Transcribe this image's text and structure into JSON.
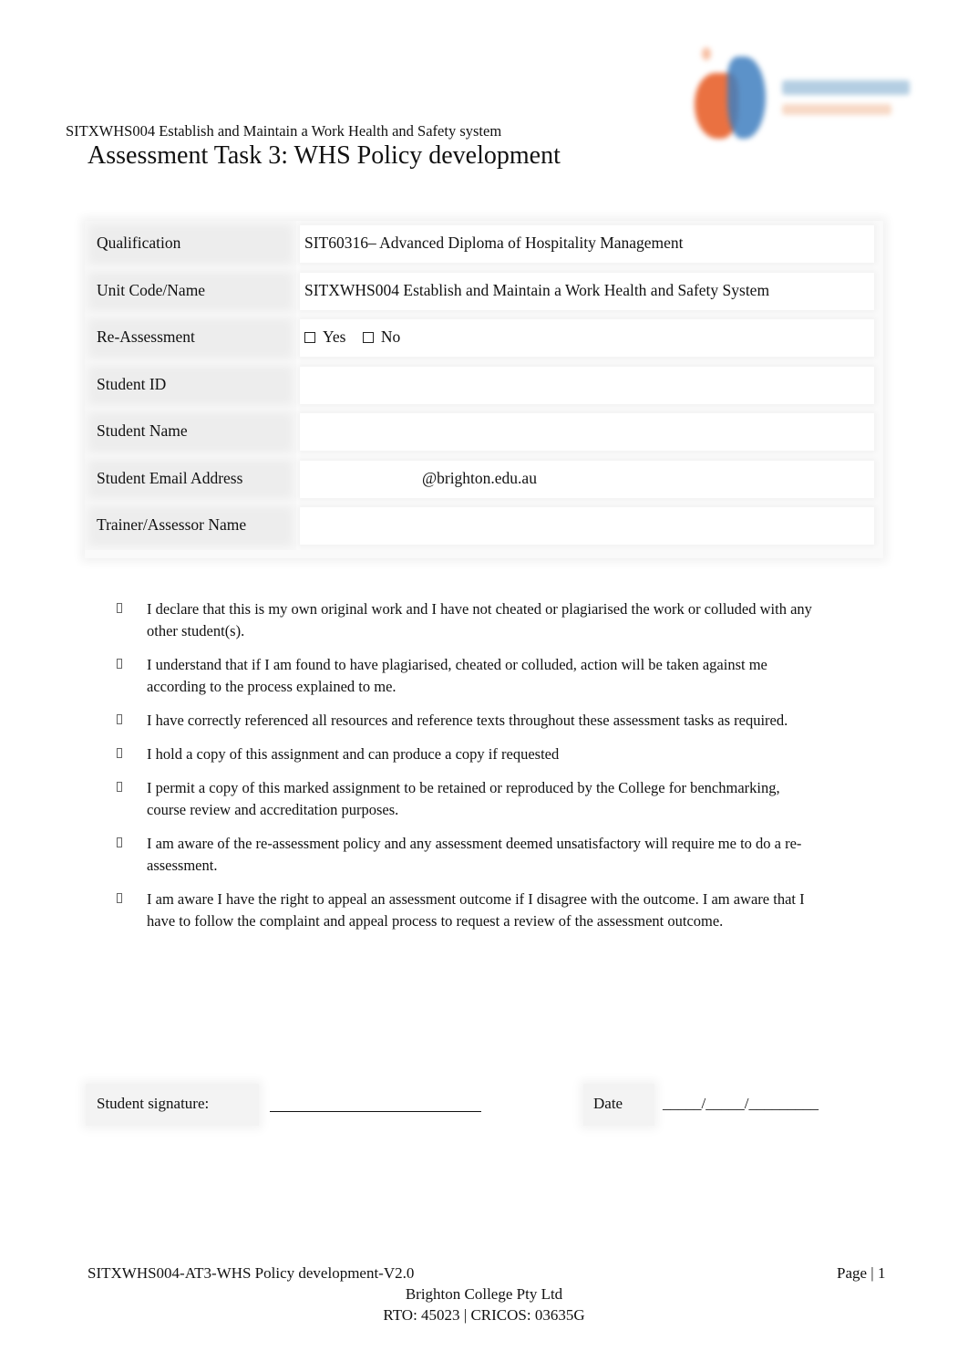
{
  "header": {
    "unit_title": "SITXWHS004 Establish and Maintain a Work Health and Safety system",
    "page_title": "Assessment Task 3: WHS Policy development",
    "logo_name": "Brighton College logo"
  },
  "info_table": {
    "rows": [
      {
        "label": "Qualification",
        "value": "SIT60316– Advanced Diploma of Hospitality Management"
      },
      {
        "label": "Unit Code/Name",
        "value": "SITXWHS004 Establish and Maintain a Work Health and Safety System"
      },
      {
        "label": "Re-Assessment",
        "options": [
          {
            "label": "Yes",
            "checked": false
          },
          {
            "label": "No",
            "checked": false
          }
        ]
      },
      {
        "label": "Student ID",
        "value": ""
      },
      {
        "label": "Student Name",
        "value": ""
      },
      {
        "label": "Student Email Address",
        "value": "",
        "suffix": "@brighton.edu.au"
      },
      {
        "label": "Trainer/Assessor Name",
        "value": ""
      }
    ]
  },
  "declarations": [
    "I declare that this is my own original work and I have not cheated or plagiarised the work or colluded with any other student(s).",
    "I understand that if I am found to have plagiarised, cheated or colluded, action will be taken against me according to the process explained to me.",
    "I have correctly referenced all resources and reference texts throughout these assessment tasks as required.",
    "I hold a copy of this assignment and can produce a copy if requested",
    "I permit a copy of this marked assignment to be retained or reproduced by the College for benchmarking, course review and accreditation purposes.",
    "I am aware of the re-assessment policy and any assessment deemed unsatisfactory will require me to do a re-assessment.",
    "I am aware I have the right to appeal an assessment outcome if I disagree with the outcome. I am aware that I have to follow the complaint and appeal process to request a review of the assessment outcome."
  ],
  "signature": {
    "label": "Student signature:",
    "value": "",
    "date_label": "Date",
    "date_placeholder": "_____/_____/_________"
  },
  "footer": {
    "document_code": "SITXWHS004-AT3-WHS Policy development-V2.0",
    "page": "Page | 1",
    "company": "Brighton College Pty Ltd",
    "rto": "RTO: 45023 | CRICOS: 03635G"
  }
}
